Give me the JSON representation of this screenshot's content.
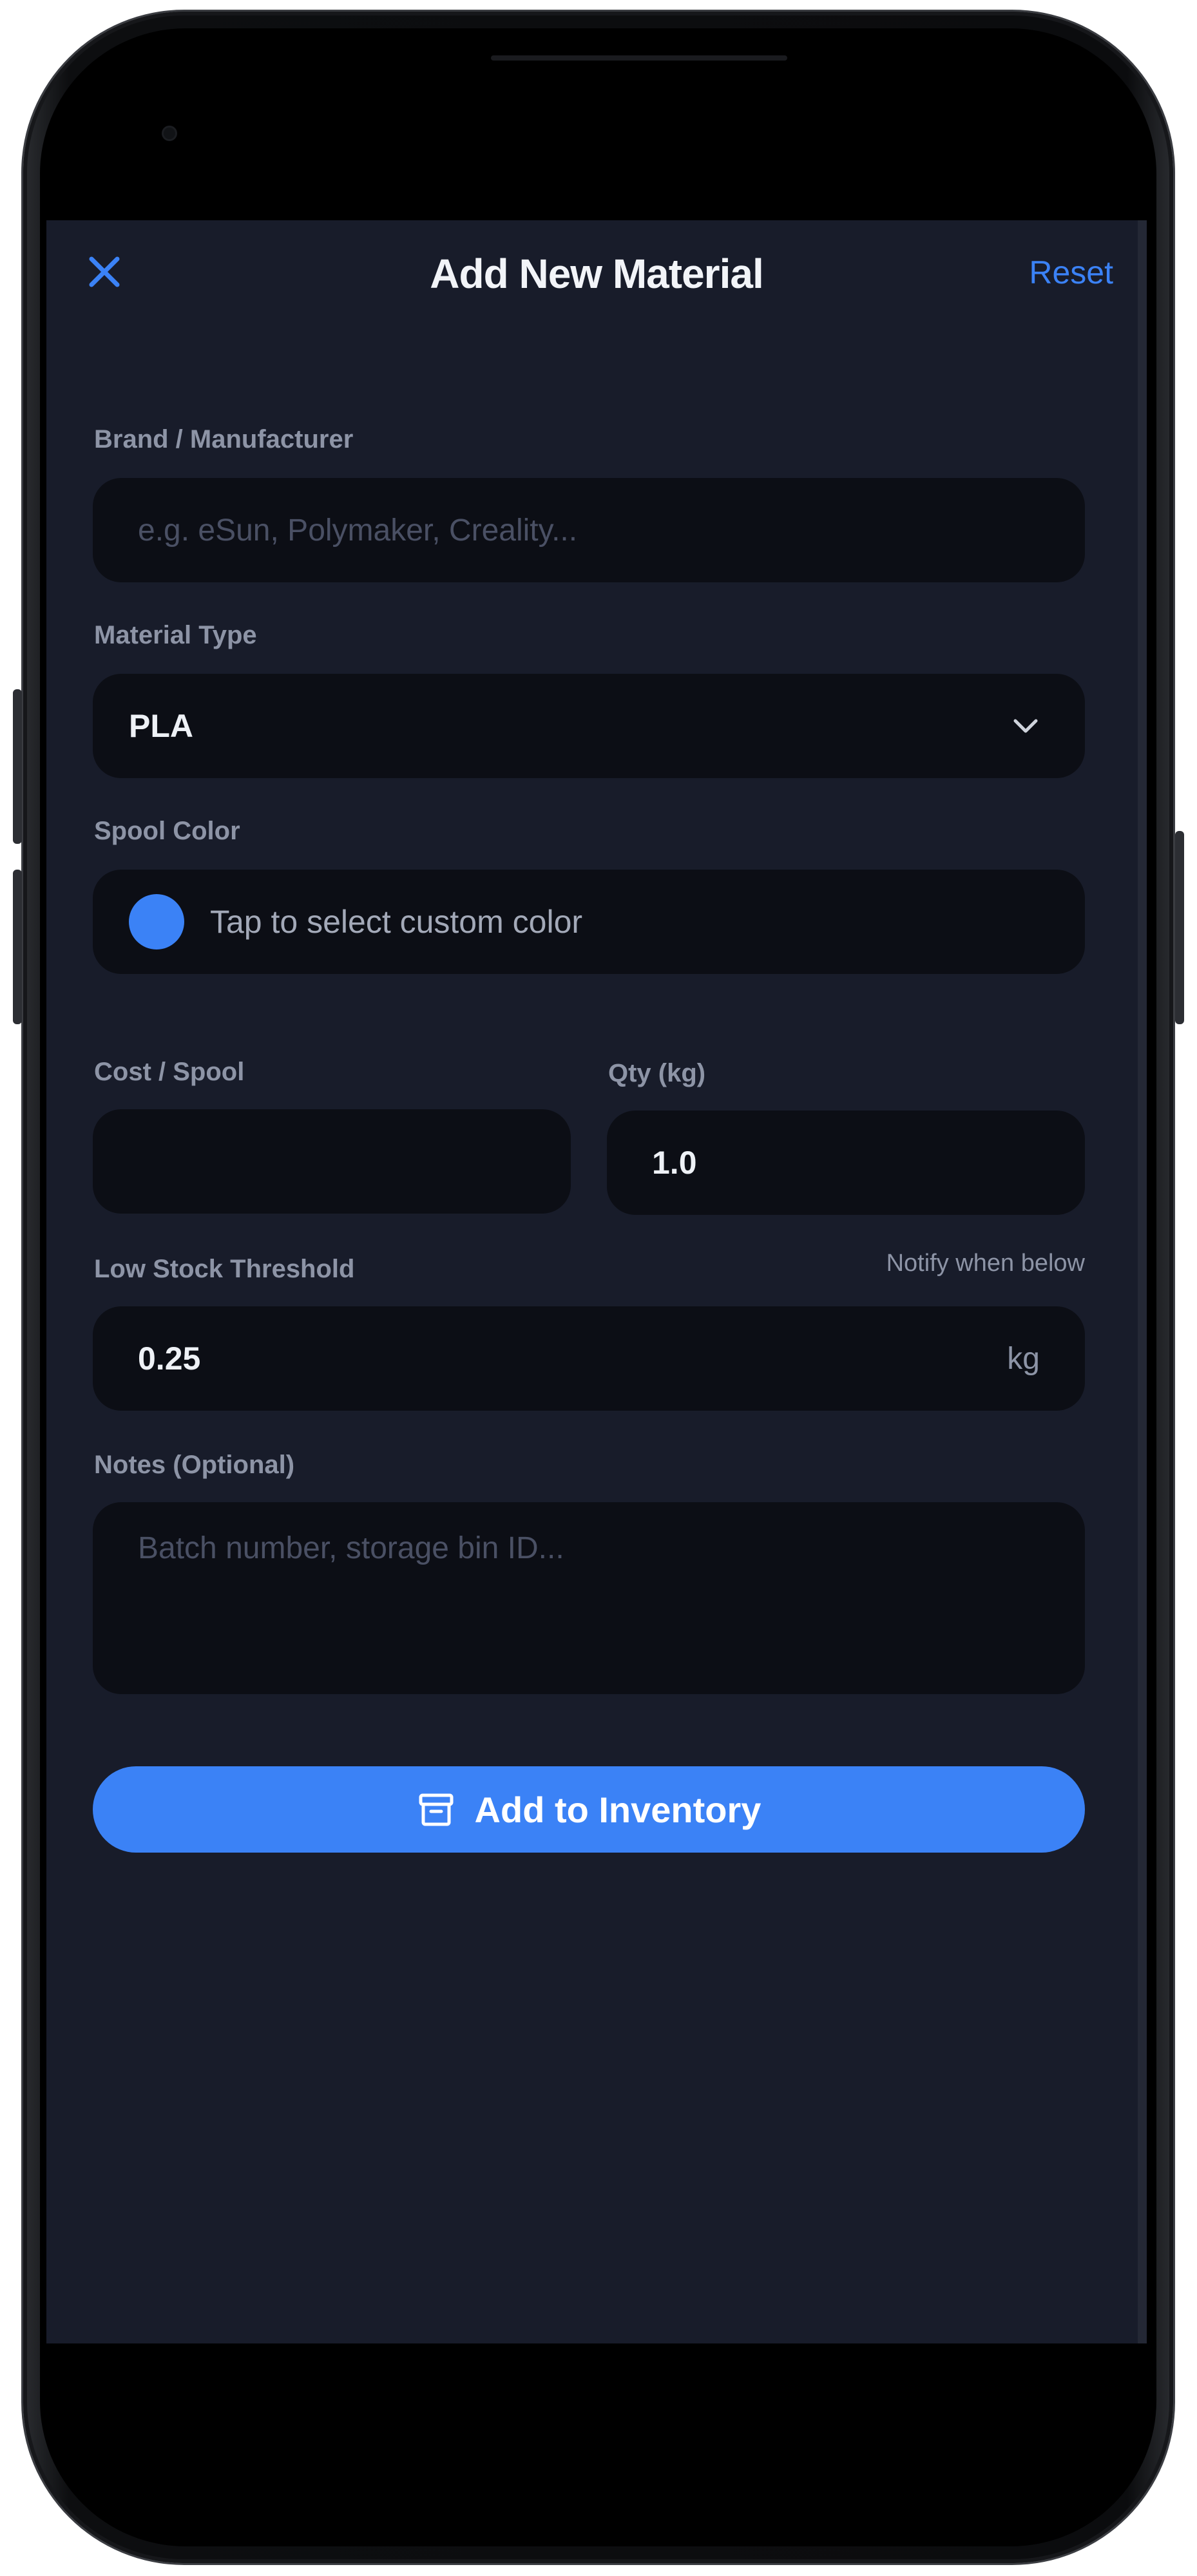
{
  "header": {
    "title": "Add New Material",
    "reset_label": "Reset"
  },
  "form": {
    "brand": {
      "label": "Brand / Manufacturer",
      "placeholder": "e.g. eSun, Polymaker, Creality...",
      "value": ""
    },
    "material_type": {
      "label": "Material Type",
      "selected": "PLA"
    },
    "spool_color": {
      "label": "Spool Color",
      "hint": "Tap to select custom color",
      "swatch_color": "#3b82f6"
    },
    "cost": {
      "label": "Cost / Spool",
      "value": ""
    },
    "qty": {
      "label": "Qty (kg)",
      "value": "1.0"
    },
    "low_stock": {
      "label": "Low Stock Threshold",
      "hint": "Notify when below",
      "value": "0.25",
      "unit": "kg"
    },
    "notes": {
      "label": "Notes (Optional)",
      "placeholder": "Batch number, storage bin ID..."
    }
  },
  "submit": {
    "label": "Add to Inventory"
  },
  "colors": {
    "accent": "#3b82f6",
    "background": "#181c2a",
    "field": "#0c0e15"
  }
}
